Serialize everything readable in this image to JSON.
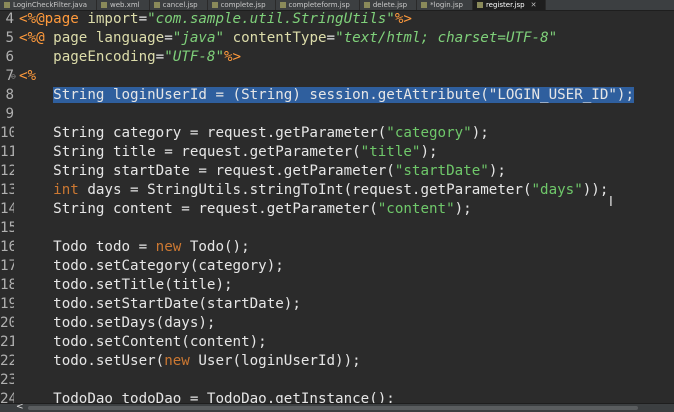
{
  "tabs": [
    {
      "label": "LoginCheckFilter.java",
      "active": false
    },
    {
      "label": "web.xml",
      "active": false
    },
    {
      "label": "cancel.jsp",
      "active": false
    },
    {
      "label": "complete.jsp",
      "active": false
    },
    {
      "label": "completeform.jsp",
      "active": false
    },
    {
      "label": "delete.jsp",
      "active": false
    },
    {
      "label": "*login.jsp",
      "active": false
    },
    {
      "label": "register.jsp",
      "active": true
    }
  ],
  "editor": {
    "lines": [
      {
        "n": "4",
        "fold": "",
        "parts": [
          [
            "delim",
            "<%@"
          ],
          [
            "kw",
            "page"
          ],
          [
            "eq",
            " "
          ],
          [
            "attr",
            "import"
          ],
          [
            "eq",
            "="
          ],
          [
            "istr",
            "\"com.sample.util.StringUtils\""
          ],
          [
            "delim",
            "%>"
          ]
        ]
      },
      {
        "n": "5",
        "fold": "",
        "parts": [
          [
            "delim",
            "<%@"
          ],
          [
            "eq",
            " "
          ],
          [
            "attr",
            "page"
          ],
          [
            "eq",
            " "
          ],
          [
            "attr",
            "language"
          ],
          [
            "eq",
            "="
          ],
          [
            "istr",
            "\"java\""
          ],
          [
            "eq",
            " "
          ],
          [
            "attr",
            "contentType"
          ],
          [
            "eq",
            "="
          ],
          [
            "istr",
            "\"text/html; charset=UTF-8\""
          ]
        ]
      },
      {
        "n": "6",
        "fold": "",
        "parts": [
          [
            "eq",
            "    "
          ],
          [
            "attr",
            "pageEncoding"
          ],
          [
            "eq",
            "="
          ],
          [
            "istr",
            "\"UTF-8\""
          ],
          [
            "delim",
            "%>"
          ]
        ]
      },
      {
        "n": "7",
        "fold": "⊖",
        "parts": [
          [
            "delim",
            "<%"
          ]
        ]
      },
      {
        "n": "8",
        "fold": "",
        "sel": true,
        "parts": [
          [
            "eq",
            "    "
          ],
          [
            "sel",
            "String loginUserId = (String) session.getAttribute(\"LOGIN_USER_ID\");"
          ]
        ]
      },
      {
        "n": "9",
        "fold": "",
        "parts": []
      },
      {
        "n": "10",
        "fold": "",
        "parts": [
          [
            "eq",
            "    String category = request.getParameter("
          ],
          [
            "str",
            "\"category\""
          ],
          [
            "eq",
            ");"
          ]
        ]
      },
      {
        "n": "11",
        "fold": "",
        "parts": [
          [
            "eq",
            "    String title = request.getParameter("
          ],
          [
            "str",
            "\"title\""
          ],
          [
            "eq",
            ");"
          ]
        ]
      },
      {
        "n": "12",
        "fold": "",
        "parts": [
          [
            "eq",
            "    String startDate = request.getParameter("
          ],
          [
            "str",
            "\"startDate\""
          ],
          [
            "eq",
            ");"
          ]
        ]
      },
      {
        "n": "13",
        "fold": "",
        "parts": [
          [
            "eq",
            "    "
          ],
          [
            "kw2",
            "int"
          ],
          [
            "eq",
            " days = StringUtils.stringToInt(request.getParameter("
          ],
          [
            "str",
            "\"days\""
          ],
          [
            "eq",
            "));"
          ]
        ]
      },
      {
        "n": "14",
        "fold": "",
        "parts": [
          [
            "eq",
            "    String content = request.getParameter("
          ],
          [
            "str",
            "\"content\""
          ],
          [
            "eq",
            ");"
          ]
        ]
      },
      {
        "n": "15",
        "fold": "",
        "parts": []
      },
      {
        "n": "16",
        "fold": "",
        "parts": [
          [
            "eq",
            "    Todo todo = "
          ],
          [
            "kw2",
            "new"
          ],
          [
            "eq",
            " Todo();"
          ]
        ]
      },
      {
        "n": "17",
        "fold": "",
        "parts": [
          [
            "eq",
            "    todo.setCategory(category);"
          ]
        ]
      },
      {
        "n": "18",
        "fold": "",
        "parts": [
          [
            "eq",
            "    todo.setTitle(title);"
          ]
        ]
      },
      {
        "n": "19",
        "fold": "",
        "parts": [
          [
            "eq",
            "    todo.setStartDate(startDate);"
          ]
        ]
      },
      {
        "n": "20",
        "fold": "",
        "parts": [
          [
            "eq",
            "    todo.setDays(days);"
          ]
        ]
      },
      {
        "n": "21",
        "fold": "",
        "parts": [
          [
            "eq",
            "    todo.setContent(content);"
          ]
        ]
      },
      {
        "n": "22",
        "fold": "",
        "parts": [
          [
            "eq",
            "    todo.setUser("
          ],
          [
            "kw2",
            "new"
          ],
          [
            "eq",
            " User(loginUserId));"
          ]
        ]
      },
      {
        "n": "23",
        "fold": "",
        "parts": []
      },
      {
        "n": "24",
        "fold": "",
        "parts": [
          [
            "eq",
            "    TodoDao todoDao = TodoDao.getInstance();"
          ]
        ]
      }
    ]
  },
  "scrollbar": {
    "arrow": "<"
  },
  "colors": {
    "background": "#2b2b2b",
    "selection": "#2f5f9e",
    "string": "#6fc86a",
    "keyword": "#ff9a3c"
  }
}
